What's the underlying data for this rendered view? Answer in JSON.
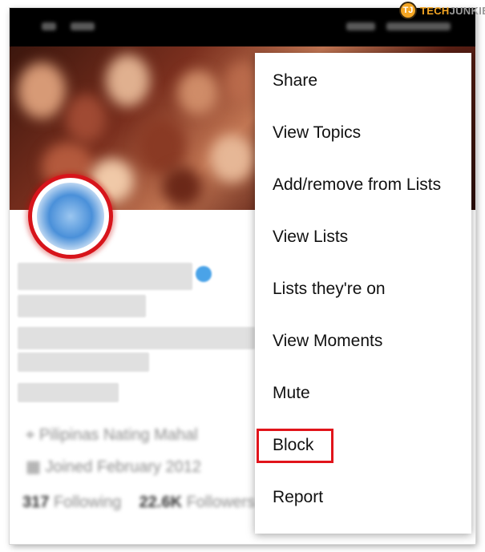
{
  "watermark": {
    "mark": "TJ",
    "brand_accent": "TECH",
    "brand_rest": "JUNKIE"
  },
  "profile": {
    "location": "Pilipinas Nating Mahal",
    "joined": "Joined February 2012",
    "following_count": "317",
    "following_label": "Following",
    "followers_count": "22.6K",
    "followers_label": "Followers"
  },
  "menu": {
    "items": [
      {
        "label": "Share"
      },
      {
        "label": "View Topics"
      },
      {
        "label": "Add/remove from Lists"
      },
      {
        "label": "View Lists"
      },
      {
        "label": "Lists they're on"
      },
      {
        "label": "View Moments"
      },
      {
        "label": "Mute"
      },
      {
        "label": "Block"
      },
      {
        "label": "Report"
      }
    ]
  },
  "colors": {
    "highlight": "#e1141b",
    "verified": "#4aa3e8",
    "brand": "#f5a623"
  }
}
